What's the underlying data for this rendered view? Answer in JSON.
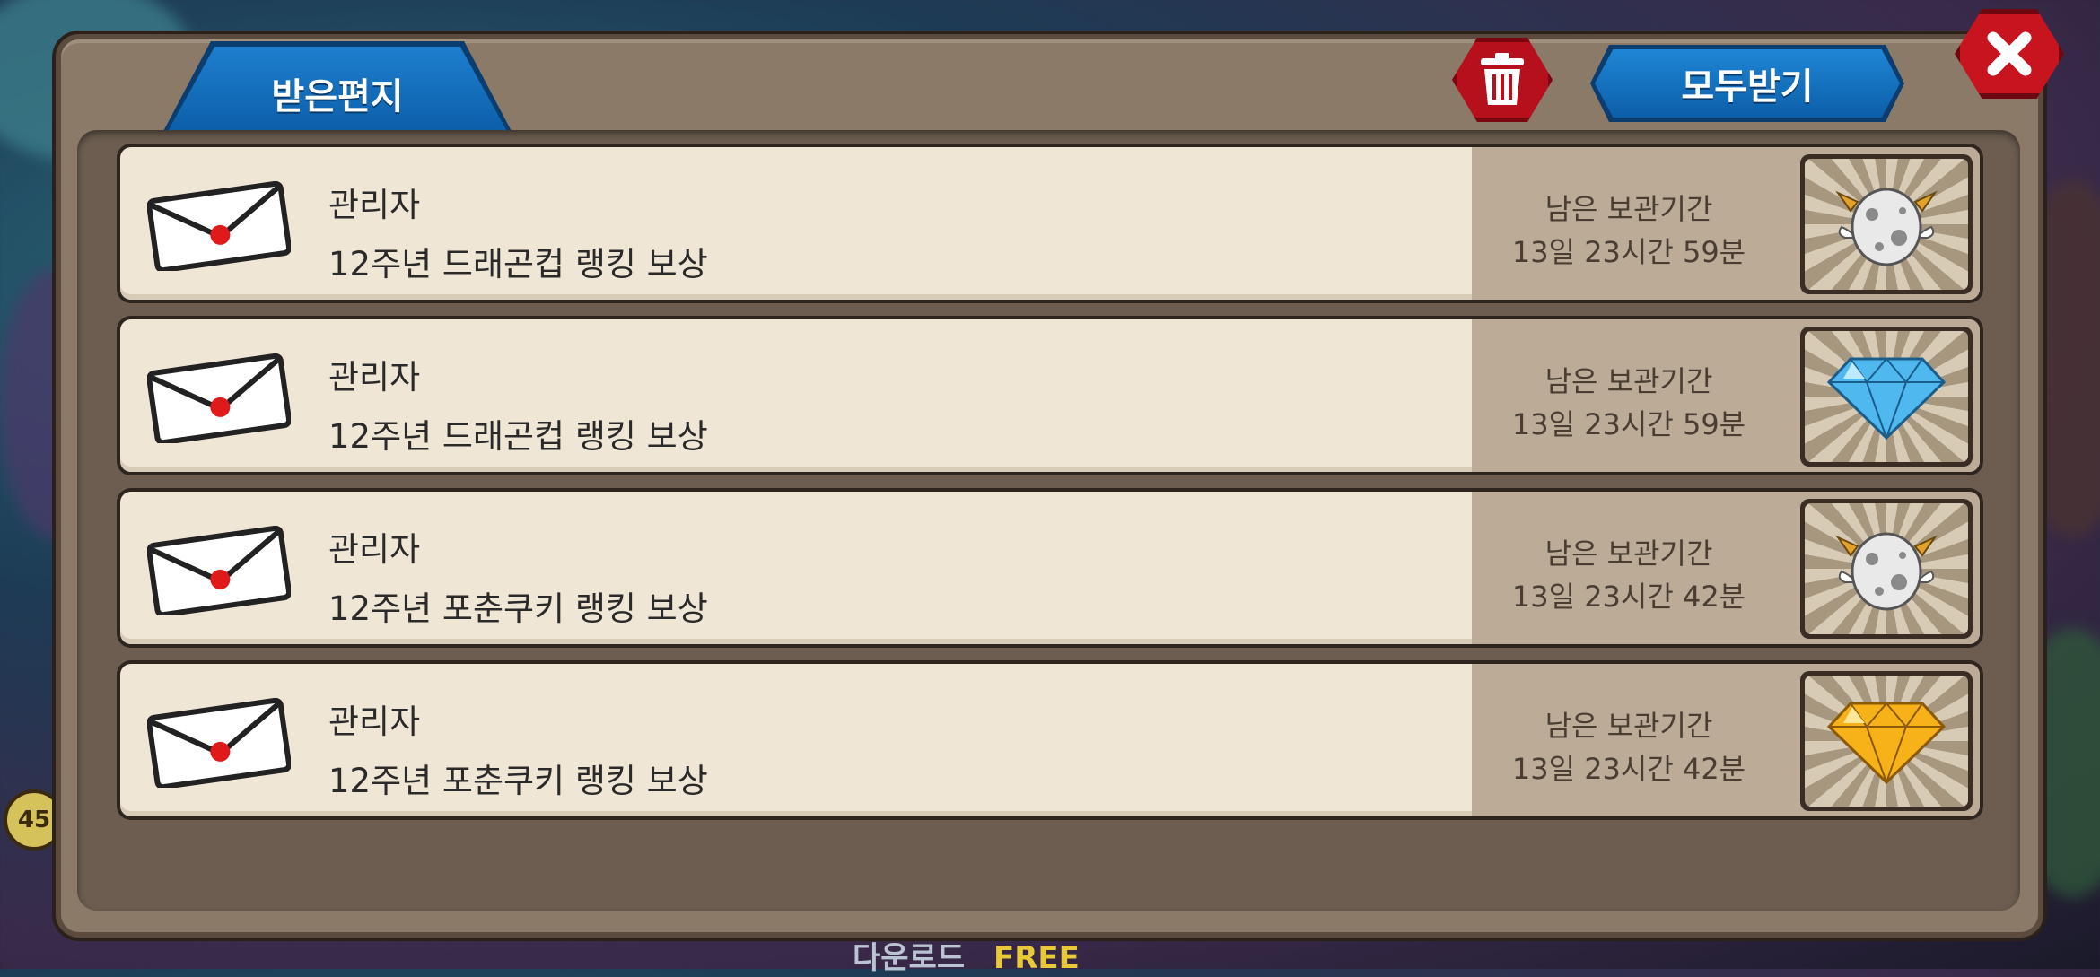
{
  "header": {
    "tab_label": "받은편지",
    "receive_all_label": "모두받기"
  },
  "mails": [
    {
      "sender": "관리자",
      "subject": "12주년 드래곤컵 랭킹 보상",
      "expiry_label": "남은 보관기간",
      "expiry_value": "13일 23시간 59분",
      "reward_icon": "monster-egg-icon"
    },
    {
      "sender": "관리자",
      "subject": "12주년 드래곤컵 랭킹 보상",
      "expiry_label": "남은 보관기간",
      "expiry_value": "13일 23시간 59분",
      "reward_icon": "blue-diamond-icon"
    },
    {
      "sender": "관리자",
      "subject": "12주년 포춘쿠키 랭킹 보상",
      "expiry_label": "남은 보관기간",
      "expiry_value": "13일 23시간 42분",
      "reward_icon": "monster-egg-icon"
    },
    {
      "sender": "관리자",
      "subject": "12주년 포춘쿠키 랭킹 보상",
      "expiry_label": "남은 보관기간",
      "expiry_value": "13일 23시간 42분",
      "reward_icon": "gold-diamond-icon"
    }
  ],
  "background": {
    "footer_download": "다운로드",
    "footer_free": "FREE",
    "badge": "45"
  },
  "colors": {
    "tab_blue": "#0c5ea8",
    "button_red": "#c7141f",
    "panel_brown": "#8c7a69",
    "row_bg": "#f0e6d6",
    "expiry_bg": "#bcab97"
  }
}
